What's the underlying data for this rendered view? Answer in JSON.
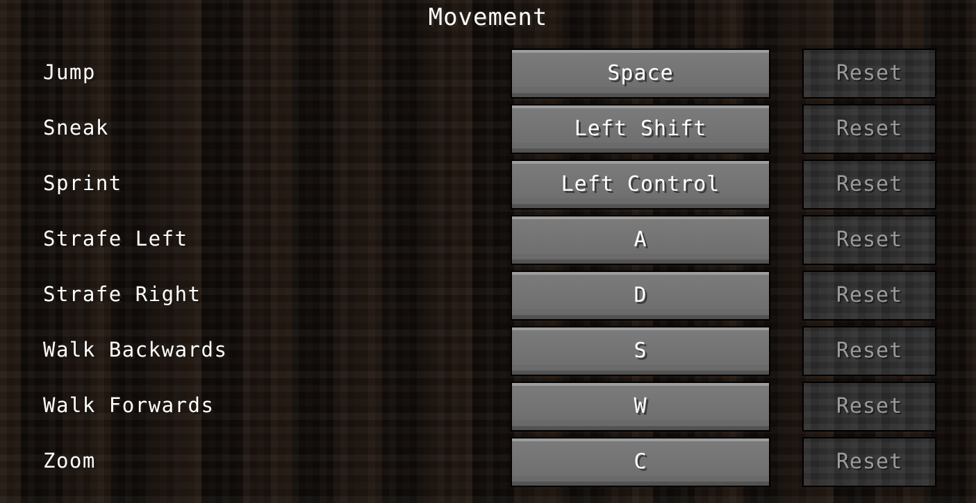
{
  "screen": {
    "title": "Movement",
    "background_color": "#160f0b",
    "title_color": "#ffffff"
  },
  "theme": {
    "key_button_color": "#6f6f6f",
    "key_button_text_color": "#ffffff",
    "reset_button_color": "#2c2c2c",
    "reset_button_text_color": "#9b9b9b",
    "label_color": "#ffffff"
  },
  "bindings": [
    {
      "action": "Jump",
      "key": "Space",
      "reset": "Reset",
      "reset_enabled": false
    },
    {
      "action": "Sneak",
      "key": "Left Shift",
      "reset": "Reset",
      "reset_enabled": false
    },
    {
      "action": "Sprint",
      "key": "Left Control",
      "reset": "Reset",
      "reset_enabled": false
    },
    {
      "action": "Strafe Left",
      "key": "A",
      "reset": "Reset",
      "reset_enabled": false
    },
    {
      "action": "Strafe Right",
      "key": "D",
      "reset": "Reset",
      "reset_enabled": false
    },
    {
      "action": "Walk Backwards",
      "key": "S",
      "reset": "Reset",
      "reset_enabled": false
    },
    {
      "action": "Walk Forwards",
      "key": "W",
      "reset": "Reset",
      "reset_enabled": false
    },
    {
      "action": "Zoom",
      "key": "C",
      "reset": "Reset",
      "reset_enabled": false
    }
  ]
}
